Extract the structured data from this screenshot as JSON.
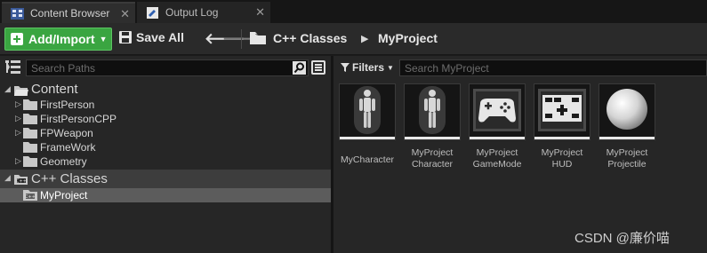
{
  "tabs": [
    {
      "label": "Content Browser",
      "icon": "content-browser-icon",
      "active": true
    },
    {
      "label": "Output Log",
      "icon": "output-log-icon",
      "active": false
    }
  ],
  "toolbar": {
    "add_import_label": "Add/Import",
    "save_all_label": "Save All",
    "breadcrumb": [
      "C++ Classes",
      "MyProject"
    ]
  },
  "sources": {
    "search_placeholder": "Search Paths",
    "tree": [
      {
        "label": "Content",
        "level": 0
      },
      {
        "label": "FirstPerson",
        "level": 1
      },
      {
        "label": "FirstPersonCPP",
        "level": 1
      },
      {
        "label": "FPWeapon",
        "level": 1
      },
      {
        "label": "FrameWork",
        "level": 1
      },
      {
        "label": "Geometry",
        "level": 1
      },
      {
        "label": "C++ Classes",
        "level": 0
      },
      {
        "label": "MyProject",
        "level": 1,
        "selected": true
      }
    ]
  },
  "assets": {
    "filters_label": "Filters",
    "search_placeholder": "Search MyProject",
    "items": [
      {
        "name": "MyCharacter",
        "icon": "character-figure-icon"
      },
      {
        "name": "MyProject Character",
        "icon": "character-figure-icon"
      },
      {
        "name": "MyProject GameMode",
        "icon": "gamepad-icon"
      },
      {
        "name": "MyProject HUD",
        "icon": "hud-icon"
      },
      {
        "name": "MyProject Projectile",
        "icon": "sphere-icon"
      }
    ]
  },
  "watermark": "CSDN @廉价喵",
  "colors": {
    "accent_green": "#3aa541",
    "background": "#262626"
  }
}
